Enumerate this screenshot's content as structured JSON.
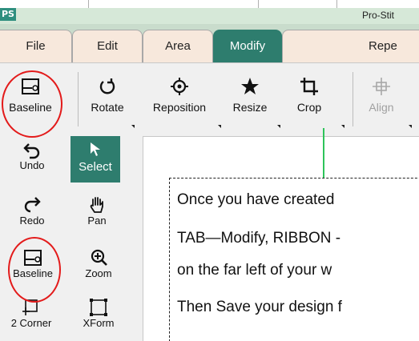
{
  "window": {
    "app_icon_text": "PS",
    "title": "Pro-Stit"
  },
  "tabs": [
    {
      "label": "File",
      "active": false
    },
    {
      "label": "Edit",
      "active": false
    },
    {
      "label": "Area",
      "active": false
    },
    {
      "label": "Modify",
      "active": true
    },
    {
      "label": "Repe",
      "active": false
    }
  ],
  "ribbon": {
    "buttons": [
      {
        "label": "Baseline",
        "icon": "baseline-icon"
      },
      {
        "label": "Rotate",
        "icon": "rotate-icon"
      },
      {
        "label": "Reposition",
        "icon": "reposition-icon"
      },
      {
        "label": "Resize",
        "icon": "resize-star-icon"
      },
      {
        "label": "Crop",
        "icon": "crop-icon"
      },
      {
        "label": "Align",
        "icon": "align-icon",
        "disabled": true
      }
    ]
  },
  "tools": [
    {
      "label": "Undo",
      "icon": "undo-icon"
    },
    {
      "label": "Select",
      "icon": "select-arrow-icon",
      "selected": true
    },
    {
      "label": "Redo",
      "icon": "redo-icon"
    },
    {
      "label": "Pan",
      "icon": "pan-hand-icon"
    },
    {
      "label": "Baseline",
      "icon": "baseline-icon"
    },
    {
      "label": "Zoom",
      "icon": "zoom-icon"
    },
    {
      "label": "2 Corner",
      "icon": "two-corner-icon"
    },
    {
      "label": "XForm",
      "icon": "xform-icon"
    }
  ],
  "callout": {
    "line1": "Once you have created",
    "line2": "TAB—Modify, RIBBON -",
    "line3": "on the far left of your w",
    "line4": "Then Save your design f"
  },
  "colors": {
    "accent": "#2e7d6e",
    "annotation": "#e31b1b",
    "guide": "#2ec45a"
  }
}
